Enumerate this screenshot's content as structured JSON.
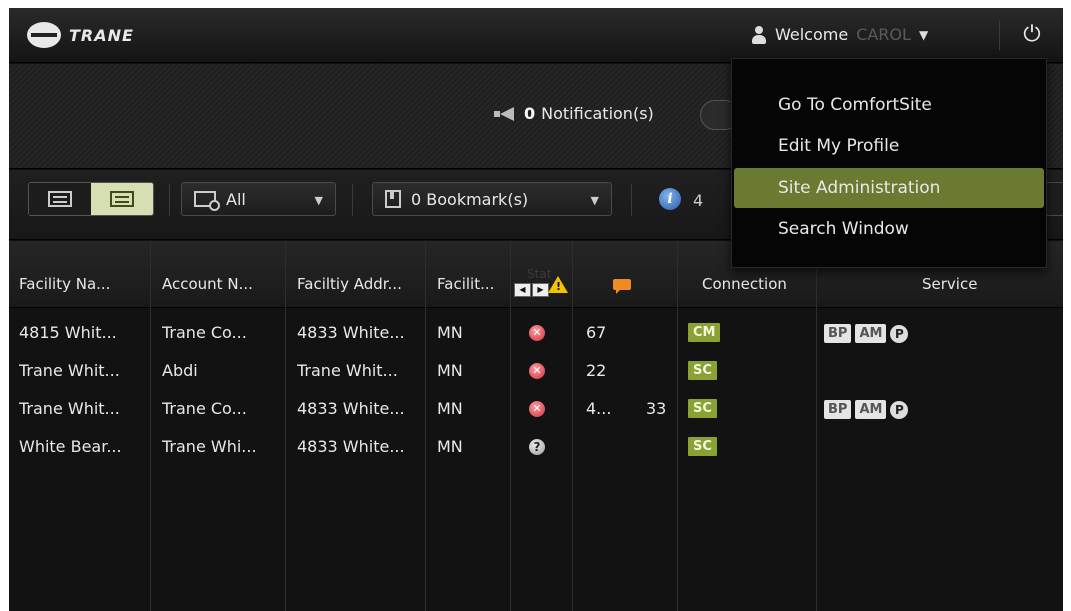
{
  "header": {
    "brand": "TRANE",
    "welcome_label": "Welcome",
    "username": "CAROL",
    "power_glyph": "⏻"
  },
  "user_menu": {
    "items": [
      {
        "label": "Go To ComfortSite",
        "active": false
      },
      {
        "label": "Edit My Profile",
        "active": false
      },
      {
        "label": "Site Administration",
        "active": true
      },
      {
        "label": "Search Window",
        "active": false
      }
    ]
  },
  "notifications": {
    "count": "0",
    "label": "Notification(s)"
  },
  "toolbar": {
    "filter_value": "All",
    "bookmarks_label": "0 Bookmark(s)",
    "trailing_text": "4"
  },
  "table": {
    "headers": {
      "facility_name": "Facility Na...",
      "account_name": "Account N...",
      "facility_address": "Faciltiy Addr...",
      "facility_state": "Facilit...",
      "connection": "Connection",
      "service": "Service"
    },
    "rows": [
      {
        "facility_name": "4815 Whit...",
        "account_name": "Trane Co...",
        "address": "4833 White...",
        "state": "MN",
        "status": "error",
        "alarms": "67",
        "comments": "",
        "connection": "CM",
        "services": [
          "BP",
          "AM",
          "P"
        ]
      },
      {
        "facility_name": "Trane Whit...",
        "account_name": "Abdi",
        "address": "Trane Whit...",
        "state": "MN",
        "status": "error",
        "alarms": "22",
        "comments": "",
        "connection": "SC",
        "services": []
      },
      {
        "facility_name": "Trane Whit...",
        "account_name": "Trane Co...",
        "address": "4833 White...",
        "state": "MN",
        "status": "error",
        "alarms": "4...",
        "comments": "33",
        "connection": "SC",
        "services": [
          "BP",
          "AM",
          "P"
        ]
      },
      {
        "facility_name": "White Bear...",
        "account_name": "Trane Whi...",
        "address": "4833 White...",
        "state": "MN",
        "status": "unknown",
        "alarms": "",
        "comments": "",
        "connection": "SC",
        "services": []
      }
    ]
  },
  "colors": {
    "menu_active": "#6a7a31",
    "connection_badge": "#8aa234",
    "status_error": "#d0303b",
    "warning": "#f2c500",
    "comment": "#f08a24"
  }
}
